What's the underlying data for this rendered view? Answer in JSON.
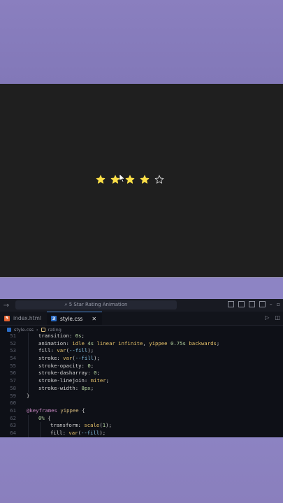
{
  "preview": {
    "rating": {
      "value": 4,
      "max": 5
    },
    "colors": {
      "filled": "#fde047",
      "empty_stroke": "#d4d4d4",
      "background": "#1f1f1f"
    }
  },
  "titlebar": {
    "command_center": "5 Star Rating Animation"
  },
  "tabs": [
    {
      "label": "index.html",
      "icon": "html-file-icon",
      "active": false
    },
    {
      "label": "style.css",
      "icon": "css-file-icon",
      "active": true
    }
  ],
  "breadcrumb": [
    "style.css",
    "rating"
  ],
  "code": [
    {
      "n": "51",
      "indent": 1,
      "parts": [
        [
          "prop",
          "transition"
        ],
        [
          "",
          ": "
        ],
        [
          "num",
          "0s"
        ],
        [
          "",
          ";"
        ]
      ]
    },
    {
      "n": "52",
      "indent": 1,
      "parts": [
        [
          "prop",
          "animation"
        ],
        [
          "",
          ": "
        ],
        [
          "val",
          "idle "
        ],
        [
          "num",
          "4s"
        ],
        [
          "val",
          " linear infinite"
        ],
        [
          "",
          ", "
        ],
        [
          "val",
          "yippee "
        ],
        [
          "num",
          "0.75s"
        ],
        [
          "val",
          " backwards"
        ],
        [
          "",
          ";"
        ]
      ]
    },
    {
      "n": "53",
      "indent": 1,
      "parts": [
        [
          "prop",
          "fill"
        ],
        [
          "",
          ": "
        ],
        [
          "fn",
          "var"
        ],
        [
          "",
          "("
        ],
        [
          "var",
          "--fill"
        ],
        [
          "",
          ");"
        ]
      ]
    },
    {
      "n": "54",
      "indent": 1,
      "parts": [
        [
          "prop",
          "stroke"
        ],
        [
          "",
          ": "
        ],
        [
          "fn",
          "var"
        ],
        [
          "",
          "("
        ],
        [
          "var",
          "--fill"
        ],
        [
          "",
          ");"
        ]
      ]
    },
    {
      "n": "55",
      "indent": 1,
      "parts": [
        [
          "prop",
          "stroke-opacity"
        ],
        [
          "",
          ": "
        ],
        [
          "num",
          "0"
        ],
        [
          "",
          ";"
        ]
      ]
    },
    {
      "n": "56",
      "indent": 1,
      "parts": [
        [
          "prop",
          "stroke-dasharray"
        ],
        [
          "",
          ": "
        ],
        [
          "num",
          "0"
        ],
        [
          "",
          ";"
        ]
      ]
    },
    {
      "n": "57",
      "indent": 1,
      "parts": [
        [
          "prop",
          "stroke-linejoin"
        ],
        [
          "",
          ": "
        ],
        [
          "val",
          "miter"
        ],
        [
          "",
          ";"
        ]
      ]
    },
    {
      "n": "58",
      "indent": 1,
      "parts": [
        [
          "prop",
          "stroke-width"
        ],
        [
          "",
          ": "
        ],
        [
          "num",
          "8px"
        ],
        [
          "",
          ";"
        ]
      ]
    },
    {
      "n": "59",
      "indent": 0,
      "parts": [
        [
          "",
          "}"
        ]
      ]
    },
    {
      "n": "60",
      "indent": 0,
      "parts": []
    },
    {
      "n": "61",
      "indent": 0,
      "parts": [
        [
          "at",
          "@keyframes"
        ],
        [
          "",
          " "
        ],
        [
          "sel",
          "yippee"
        ],
        [
          "",
          " {"
        ]
      ]
    },
    {
      "n": "62",
      "indent": 1,
      "parts": [
        [
          "num",
          "0%"
        ],
        [
          "",
          " {"
        ]
      ]
    },
    {
      "n": "63",
      "indent": 2,
      "parts": [
        [
          "prop",
          "transform"
        ],
        [
          "",
          ": "
        ],
        [
          "fn",
          "scale"
        ],
        [
          "",
          "("
        ],
        [
          "num",
          "1"
        ],
        [
          "",
          ");"
        ]
      ]
    },
    {
      "n": "64",
      "indent": 2,
      "parts": [
        [
          "prop",
          "fill"
        ],
        [
          "",
          ": "
        ],
        [
          "fn",
          "var"
        ],
        [
          "",
          "("
        ],
        [
          "var",
          "--fill"
        ],
        [
          "",
          ");"
        ]
      ]
    }
  ]
}
